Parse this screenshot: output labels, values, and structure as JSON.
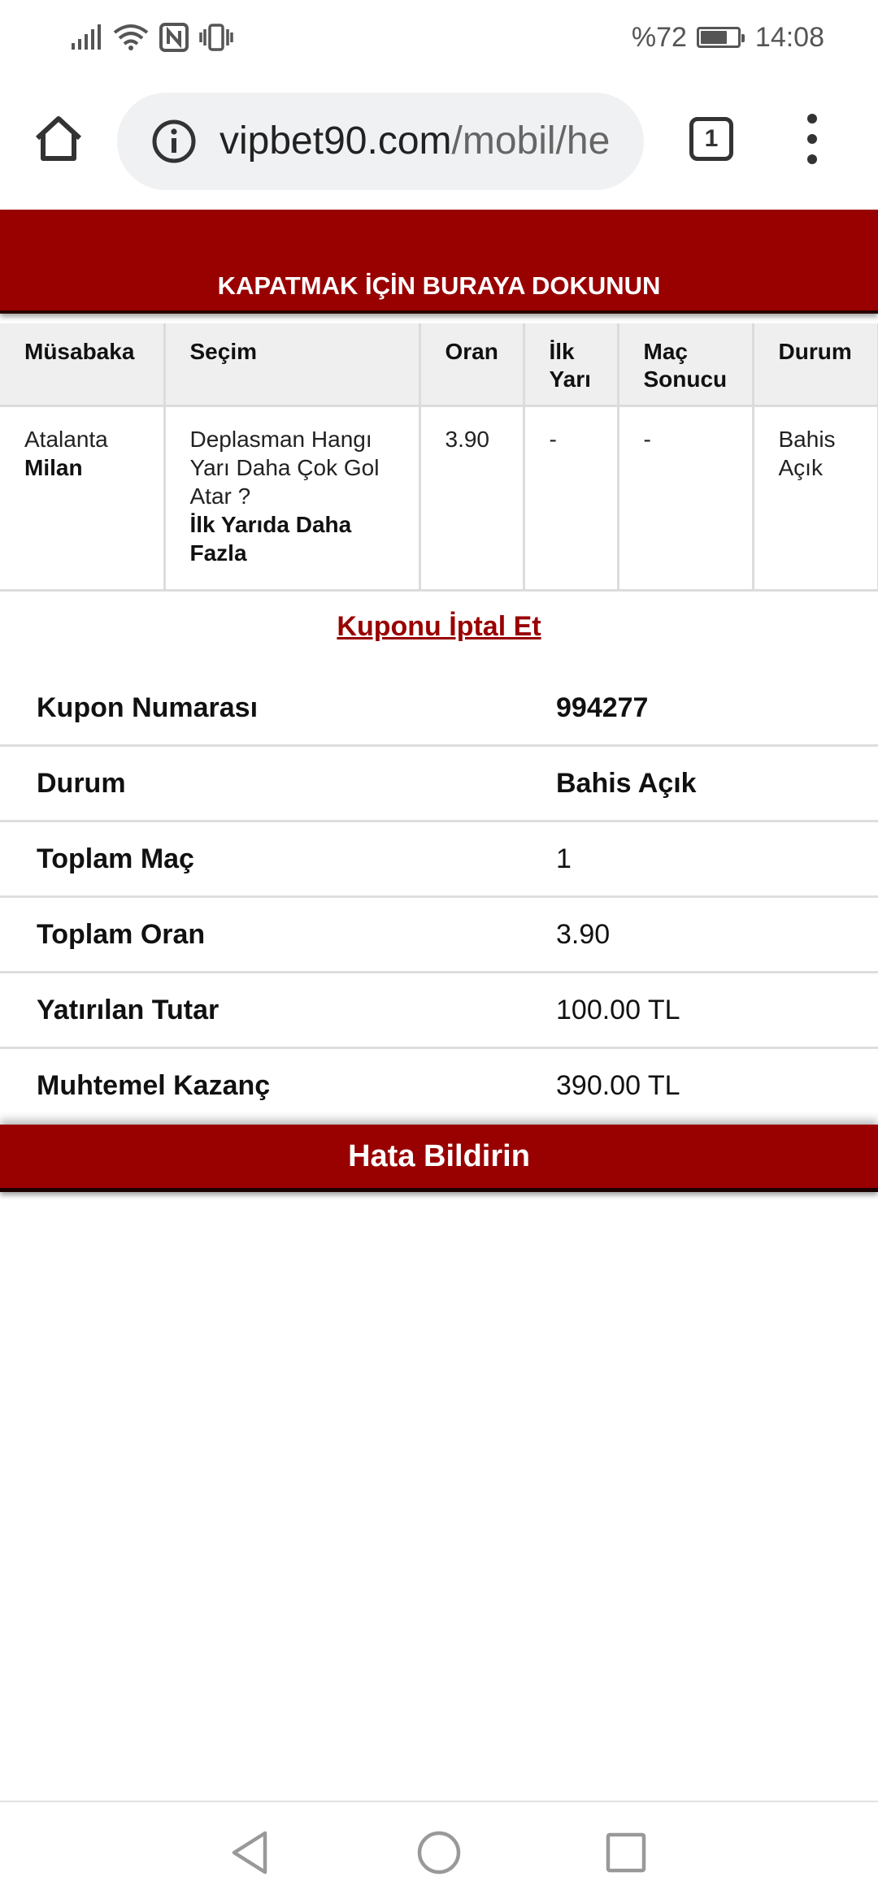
{
  "status_bar": {
    "battery_text": "%72",
    "battery_level": 0.72,
    "time": "14:08"
  },
  "browser": {
    "url_host": "vipbet90.com",
    "url_path": "/mobil/he",
    "tab_count": "1"
  },
  "page": {
    "close_banner": "KAPATMAK İÇİN BURAYA DOKUNUN",
    "table": {
      "headers": [
        "Müsabaka",
        "Seçim",
        "Oran",
        "İlk Yarı",
        "Maç Sonucu",
        "Durum"
      ],
      "rows": [
        {
          "home_team": "Atalanta",
          "away_team": "Milan",
          "selection_question": "Deplasman Hangı Yarı Daha Çok Gol Atar ?",
          "selection_answer": "İlk Yarıda Daha Fazla",
          "odds": "3.90",
          "first_half": "-",
          "match_result": "-",
          "status": "Bahis Açık"
        }
      ]
    },
    "cancel_link": "Kuponu İptal Et",
    "summary": [
      {
        "label": "Kupon Numarası",
        "value": "994277"
      },
      {
        "label": "Durum",
        "value": "Bahis Açık"
      },
      {
        "label": "Toplam Maç",
        "value": "1"
      },
      {
        "label": "Toplam Oran",
        "value": "3.90"
      },
      {
        "label": "Yatırılan Tutar",
        "value": "100.00 TL"
      },
      {
        "label": "Muhtemel Kazanç",
        "value": "390.00 TL"
      }
    ],
    "report_button": "Hata Bildirin"
  },
  "colors": {
    "brand": "#990000",
    "header_bg": "#efefef"
  },
  "icons": [
    "signal-icon",
    "wifi-icon",
    "nfc-icon",
    "vibrate-icon",
    "battery-icon",
    "home-icon",
    "info-icon",
    "tabs-icon",
    "menu-icon",
    "back-icon",
    "home-circle-icon",
    "recents-icon"
  ]
}
